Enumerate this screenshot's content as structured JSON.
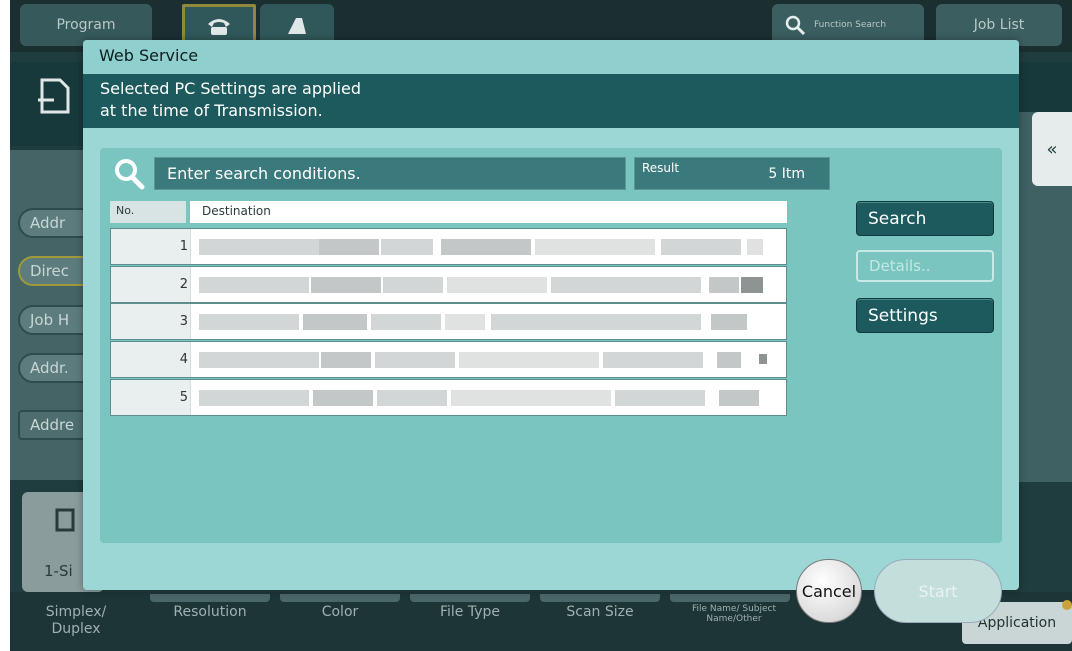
{
  "background": {
    "tabs": {
      "program": "Program",
      "function_search": "Function Search",
      "job_list": "Job List"
    },
    "side_buttons": [
      "Addr",
      "Direc",
      "Job H",
      "Addr.",
      "Addre"
    ],
    "left_bottom_label": "1-Si",
    "bottom_functions": [
      "Simplex/ Duplex",
      "Resolution",
      "Color",
      "File Type",
      "Scan Size",
      "File Name/ Subject Name/Other"
    ],
    "application": "Application"
  },
  "dialog": {
    "title": "Web Service",
    "message": "Selected PC Settings are applied\nat the time of Transmission.",
    "search_placeholder": "Enter search conditions.",
    "result_label": "Result",
    "result_value": "5 Itm",
    "columns": {
      "no": "No.",
      "destination": "Destination"
    },
    "rows": [
      {
        "no": "1"
      },
      {
        "no": "2"
      },
      {
        "no": "3"
      },
      {
        "no": "4"
      },
      {
        "no": "5"
      }
    ],
    "buttons": {
      "search": "Search",
      "details": "Details..",
      "settings": "Settings"
    }
  },
  "actions": {
    "cancel": "Cancel",
    "start": "Start"
  },
  "colors": {
    "dialog_bg": "#9cd7d5",
    "header_bar": "#1d5a5e",
    "body_panel": "#7ac5c0",
    "button": "#1d5a5e",
    "background_panel": "#1f3c3e"
  }
}
